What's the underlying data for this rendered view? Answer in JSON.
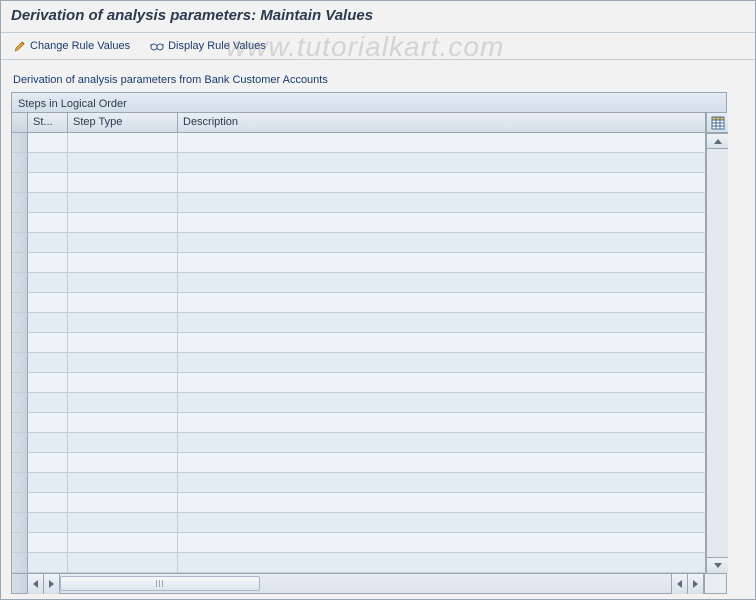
{
  "window": {
    "title": "Derivation of analysis parameters: Maintain Values"
  },
  "toolbar": {
    "change_label": "Change Rule Values",
    "display_label": "Display Rule Values"
  },
  "content": {
    "subheading": "Derivation of analysis parameters from Bank Customer Accounts"
  },
  "grid": {
    "title": "Steps in Logical Order",
    "columns": {
      "step_no": "St...",
      "step_type": "Step Type",
      "description": "Description"
    },
    "row_count": 22
  },
  "watermark": "www.tutorialkart.com"
}
